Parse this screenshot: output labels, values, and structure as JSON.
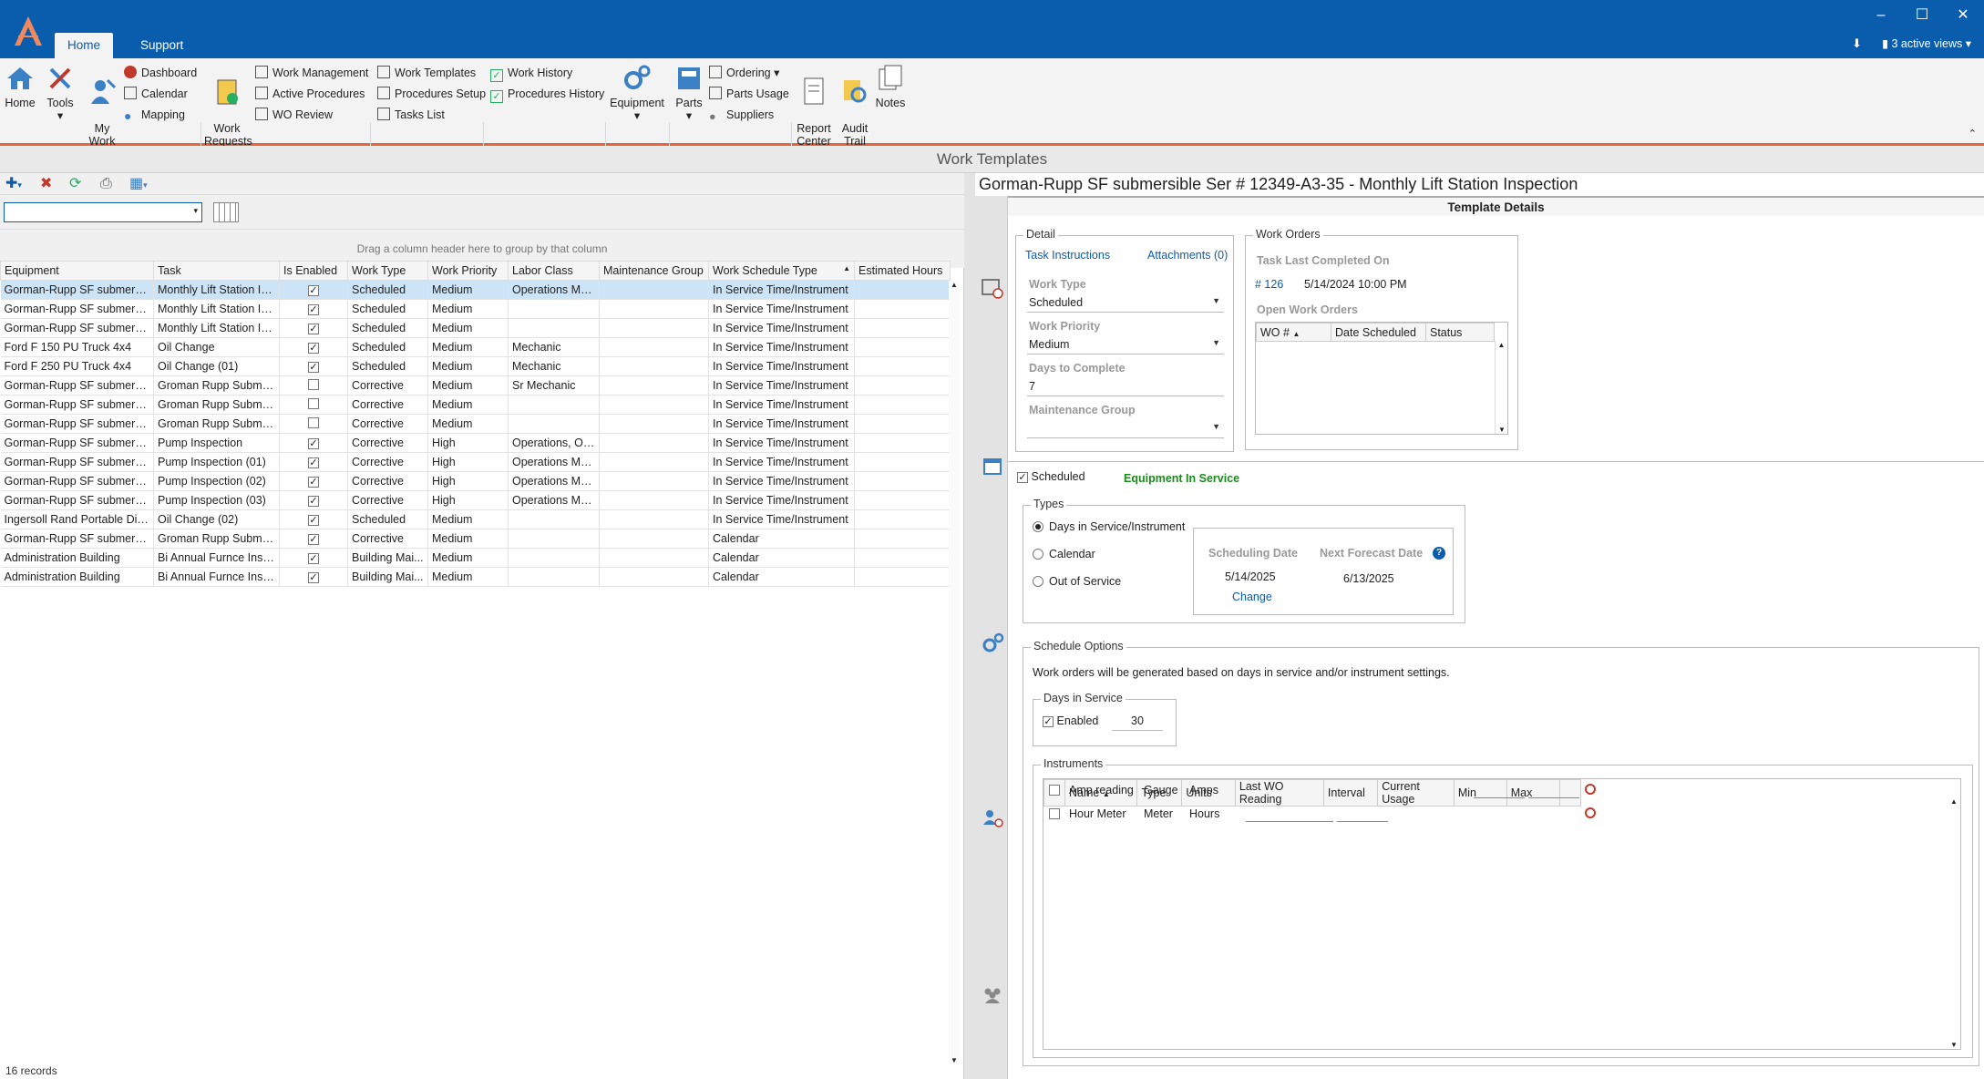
{
  "ribbon_tabs": [
    {
      "label": "Home"
    },
    {
      "label": "Support"
    }
  ],
  "views_label": "3 active views",
  "ribbon": {
    "home": "Home",
    "tools": "Tools",
    "my_work": "My\nWork",
    "dashboard": "Dashboard",
    "calendar": "Calendar",
    "mapping": "Mapping",
    "work_requests": "Work\nRequests",
    "work_management": "Work Management",
    "active_procedures": "Active Procedures",
    "wo_review": "WO Review",
    "work_templates": "Work Templates",
    "procedures_setup": "Procedures Setup",
    "tasks_list": "Tasks List",
    "work_history": "Work History",
    "procedures_history": "Procedures History",
    "equipment": "Equipment",
    "parts": "Parts",
    "ordering": "Ordering",
    "parts_usage": "Parts Usage",
    "suppliers": "Suppliers",
    "report_center": "Report\nCenter",
    "audit_trail": "Audit\nTrail",
    "notes": "Notes"
  },
  "app_title": "Work Templates",
  "group_hint": "Drag a column header here to group by that column",
  "grid": {
    "columns": [
      "Equipment",
      "Task",
      "Is Enabled",
      "Work Type",
      "Work Priority",
      "Labor Class",
      "Maintenance Group",
      "Work Schedule Type",
      "Estimated Hours"
    ],
    "rows": [
      {
        "equipment": "Gorman-Rupp SF submersib...",
        "task": "Monthly Lift Station In...",
        "enabled": true,
        "type": "Scheduled",
        "priority": "Medium",
        "labor": "Operations Me...",
        "group": "",
        "schedule": "In Service Time/Instrument",
        "hours": ""
      },
      {
        "equipment": "Gorman-Rupp SF submersib...",
        "task": "Monthly Lift Station In...",
        "enabled": true,
        "type": "Scheduled",
        "priority": "Medium",
        "labor": "",
        "group": "",
        "schedule": "In Service Time/Instrument",
        "hours": ""
      },
      {
        "equipment": "Gorman-Rupp SF submersib...",
        "task": "Monthly Lift Station In...",
        "enabled": true,
        "type": "Scheduled",
        "priority": "Medium",
        "labor": "",
        "group": "",
        "schedule": "In Service Time/Instrument",
        "hours": ""
      },
      {
        "equipment": "Ford F 150 PU Truck 4x4",
        "task": "Oil Change",
        "enabled": true,
        "type": "Scheduled",
        "priority": "Medium",
        "labor": "Mechanic",
        "group": "",
        "schedule": "In Service Time/Instrument",
        "hours": ""
      },
      {
        "equipment": "Ford F 250 PU Truck 4x4",
        "task": "Oil Change (01)",
        "enabled": true,
        "type": "Scheduled",
        "priority": "Medium",
        "labor": "Mechanic",
        "group": "",
        "schedule": "In Service Time/Instrument",
        "hours": ""
      },
      {
        "equipment": "Gorman-Rupp SF submersib...",
        "task": "Groman Rupp Submer...",
        "enabled": false,
        "type": "Corrective",
        "priority": "Medium",
        "labor": "Sr Mechanic",
        "group": "",
        "schedule": "In Service Time/Instrument",
        "hours": ""
      },
      {
        "equipment": "Gorman-Rupp SF submersib...",
        "task": "Groman Rupp Submer...",
        "enabled": false,
        "type": "Corrective",
        "priority": "Medium",
        "labor": "",
        "group": "",
        "schedule": "In Service Time/Instrument",
        "hours": ""
      },
      {
        "equipment": "Gorman-Rupp SF submersib...",
        "task": "Groman Rupp Submer...",
        "enabled": false,
        "type": "Corrective",
        "priority": "Medium",
        "labor": "",
        "group": "",
        "schedule": "In Service Time/Instrument",
        "hours": ""
      },
      {
        "equipment": "Gorman-Rupp SF submersib...",
        "task": "Pump Inspection",
        "enabled": true,
        "type": "Corrective",
        "priority": "High",
        "labor": "Operations, Op...",
        "group": "",
        "schedule": "In Service Time/Instrument",
        "hours": ""
      },
      {
        "equipment": "Gorman-Rupp SF submersib...",
        "task": "Pump Inspection (01)",
        "enabled": true,
        "type": "Corrective",
        "priority": "High",
        "labor": "Operations Me...",
        "group": "",
        "schedule": "In Service Time/Instrument",
        "hours": ""
      },
      {
        "equipment": "Gorman-Rupp SF submersib...",
        "task": "Pump Inspection (02)",
        "enabled": true,
        "type": "Corrective",
        "priority": "High",
        "labor": "Operations Me...",
        "group": "",
        "schedule": "In Service Time/Instrument",
        "hours": ""
      },
      {
        "equipment": "Gorman-Rupp SF submersib...",
        "task": "Pump Inspection (03)",
        "enabled": true,
        "type": "Corrective",
        "priority": "High",
        "labor": "Operations Me...",
        "group": "",
        "schedule": "In Service Time/Instrument",
        "hours": ""
      },
      {
        "equipment": "Ingersoll Rand Portable Dies...",
        "task": "Oil Change (02)",
        "enabled": true,
        "type": "Scheduled",
        "priority": "Medium",
        "labor": "",
        "group": "",
        "schedule": "In Service Time/Instrument",
        "hours": ""
      },
      {
        "equipment": "Gorman-Rupp SF submersib...",
        "task": "Groman Rupp Submer...",
        "enabled": true,
        "type": "Corrective",
        "priority": "Medium",
        "labor": "",
        "group": "",
        "schedule": "Calendar",
        "hours": ""
      },
      {
        "equipment": "Administration Building",
        "task": "Bi Annual Furnce Insp...",
        "enabled": true,
        "type": "Building Mai...",
        "priority": "Medium",
        "labor": "",
        "group": "",
        "schedule": "Calendar",
        "hours": ""
      },
      {
        "equipment": "Administration Building",
        "task": "Bi Annual Furnce Insp...",
        "enabled": true,
        "type": "Building Mai...",
        "priority": "Medium",
        "labor": "",
        "group": "",
        "schedule": "Calendar",
        "hours": ""
      }
    ]
  },
  "records": "16 records",
  "detail_title": "Gorman-Rupp SF submersible Ser #  12349-A3-35 - Monthly Lift Station Inspection",
  "template_details": "Template Details",
  "detail": {
    "legend": "Detail",
    "task_instructions": "Task Instructions",
    "attachments": "Attachments (0)",
    "work_type_label": "Work Type",
    "work_type": "Scheduled",
    "work_priority_label": "Work Priority",
    "work_priority": "Medium",
    "days_label": "Days to Complete",
    "days": "7",
    "group_label": "Maintenance Group",
    "group": ""
  },
  "work_orders": {
    "legend": "Work Orders",
    "last_completed_label": "Task Last Completed On",
    "wo_link": "# 126",
    "last_completed": "5/14/2024 10:00 PM",
    "open_label": "Open Work Orders",
    "cols": [
      "WO #",
      "Date Scheduled",
      "Status"
    ]
  },
  "scheduled_label": "Scheduled",
  "equipment_status": "Equipment In Service",
  "types": {
    "legend": "Types",
    "opt1": "Days in Service/Instrument",
    "opt2": "Calendar",
    "opt3": "Out of Service",
    "sched_date_label": "Scheduling Date",
    "forecast_label": "Next Forecast Date",
    "sched_date": "5/14/2025",
    "forecast": "6/13/2025",
    "change": "Change"
  },
  "options": {
    "legend": "Schedule Options",
    "note": "Work orders will be generated based on days in service and/or instrument settings.",
    "dis_legend": "Days in Service",
    "enabled_label": "Enabled",
    "days_value": "30"
  },
  "instruments": {
    "legend": "Instruments",
    "cols": [
      "Name",
      "Type",
      "Units",
      "Last WO Reading",
      "Interval",
      "Current Usage",
      "Min",
      "Max"
    ],
    "rows": [
      {
        "name": "Amp reading",
        "type": "Gauge",
        "units": "Amps"
      },
      {
        "name": "Hour Meter",
        "type": "Meter",
        "units": "Hours"
      }
    ]
  },
  "colors": {
    "brand": "#0a5cad",
    "accent": "#e8623c",
    "status_green": "#1a8a1a"
  }
}
